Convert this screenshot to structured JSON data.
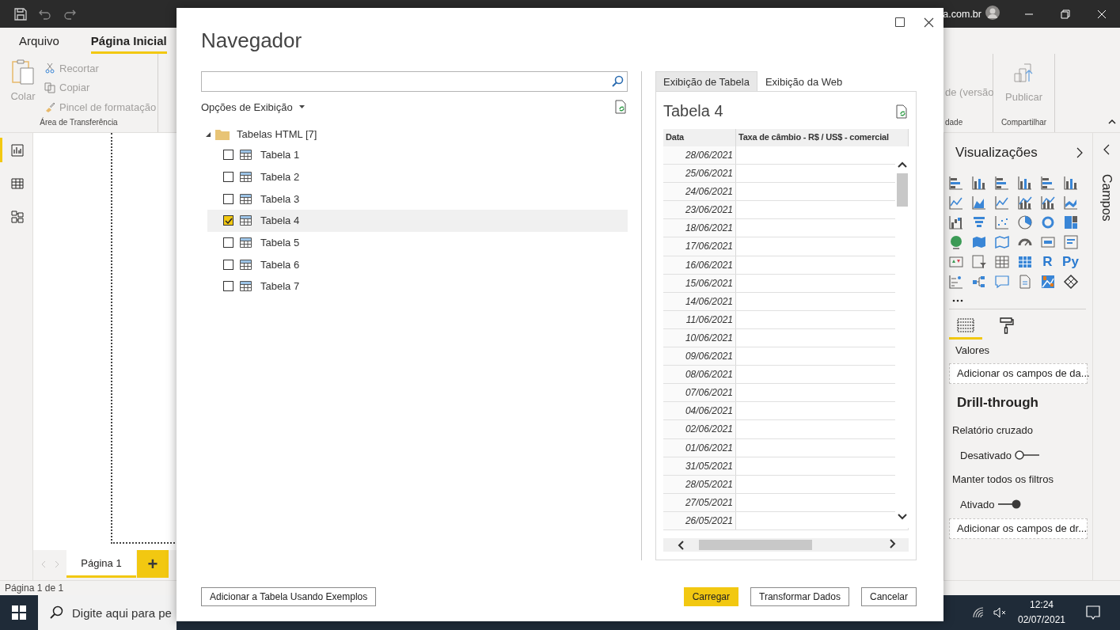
{
  "title_bar": {
    "account_text": "a.com.br"
  },
  "ribbon_tabs": [
    {
      "label": "Arquivo",
      "selected": false
    },
    {
      "label": "Página Inicial",
      "selected": true
    }
  ],
  "ribbon": {
    "clipboard": {
      "paste": {
        "label": "Colar",
        "disabled": true
      },
      "items": [
        {
          "label": "Recortar",
          "disabled": true
        },
        {
          "label": "Copiar",
          "disabled": true
        },
        {
          "label": "Pincel de formatação",
          "disabled": true
        }
      ],
      "group_label": "Área de Transferência"
    },
    "partial_group": {
      "button_label": "de (versão",
      "group_label": "dade"
    },
    "share": {
      "publish": {
        "label": "Publicar",
        "disabled": true
      },
      "group_label": "Compartilhar"
    }
  },
  "views": [
    {
      "selected": true
    },
    {
      "selected": false
    },
    {
      "selected": false
    }
  ],
  "page_tabs": [
    {
      "label": "Página 1",
      "selected": true
    }
  ],
  "add_page_label": "+",
  "status_bar": {
    "text": "Página 1 de 1"
  },
  "visualizations": {
    "title": "Visualizações",
    "visuals": [
      {
        "kind": "icon"
      },
      {
        "kind": "icon"
      },
      {
        "kind": "icon"
      },
      {
        "kind": "icon"
      },
      {
        "kind": "icon"
      },
      {
        "kind": "icon"
      },
      {
        "kind": "icon"
      },
      {
        "kind": "icon"
      },
      {
        "kind": "icon"
      },
      {
        "kind": "icon"
      },
      {
        "kind": "icon"
      },
      {
        "kind": "icon"
      },
      {
        "kind": "icon"
      },
      {
        "kind": "icon"
      },
      {
        "kind": "icon"
      },
      {
        "kind": "icon"
      },
      {
        "kind": "icon"
      },
      {
        "kind": "icon"
      },
      {
        "kind": "icon"
      },
      {
        "kind": "icon"
      },
      {
        "kind": "icon"
      },
      {
        "kind": "icon"
      },
      {
        "kind": "icon"
      },
      {
        "kind": "icon"
      },
      {
        "kind": "icon"
      },
      {
        "kind": "icon"
      },
      {
        "kind": "icon"
      },
      {
        "kind": "icon"
      },
      {
        "kind": "text",
        "label": "R"
      },
      {
        "kind": "text",
        "label": "Py"
      },
      {
        "kind": "icon"
      },
      {
        "kind": "icon"
      },
      {
        "kind": "icon"
      },
      {
        "kind": "icon"
      },
      {
        "kind": "icon"
      },
      {
        "kind": "icon"
      }
    ],
    "pane_tabs": [
      {
        "selected": true
      },
      {
        "selected": false
      }
    ],
    "values_label": "Valores",
    "values_well": "Adicionar os campos de da...",
    "drill_title": "Drill-through",
    "cross_report": {
      "label": "Relatório cruzado",
      "state_label": "Desativado",
      "on": false
    },
    "keep_filters": {
      "label": "Manter todos os filtros",
      "state_label": "Ativado",
      "on": true
    },
    "drill_well": "Adicionar os campos de dr..."
  },
  "fields_pane": {
    "title": "Campos"
  },
  "taskbar": {
    "search_placeholder": "Digite aqui para pe",
    "time": "12:24",
    "date": "02/07/2021"
  },
  "navigator": {
    "title": "Navegador",
    "display_options_label": "Opções de Exibição",
    "tree": [
      {
        "label": "Tabelas HTML [7]",
        "expanded": true,
        "children": [
          {
            "label": "Tabela 1",
            "checked": false,
            "selected": false
          },
          {
            "label": "Tabela 2",
            "checked": false,
            "selected": false
          },
          {
            "label": "Tabela 3",
            "checked": false,
            "selected": false
          },
          {
            "label": "Tabela 4",
            "checked": true,
            "selected": true
          },
          {
            "label": "Tabela 5",
            "checked": false,
            "selected": false
          },
          {
            "label": "Tabela 6",
            "checked": false,
            "selected": false
          },
          {
            "label": "Tabela 7",
            "checked": false,
            "selected": false
          }
        ]
      }
    ],
    "preview": {
      "tabs": [
        {
          "label": "Exibição de Tabela",
          "selected": true
        },
        {
          "label": "Exibição da Web",
          "selected": false
        }
      ],
      "title": "Tabela 4",
      "columns": [
        "Data",
        "Taxa de câmbio - R$ / US$ - comercial"
      ],
      "rows": [
        {
          "data": "28/06/2021"
        },
        {
          "data": "25/06/2021"
        },
        {
          "data": "24/06/2021"
        },
        {
          "data": "23/06/2021"
        },
        {
          "data": "18/06/2021"
        },
        {
          "data": "17/06/2021"
        },
        {
          "data": "16/06/2021"
        },
        {
          "data": "15/06/2021"
        },
        {
          "data": "14/06/2021"
        },
        {
          "data": "11/06/2021"
        },
        {
          "data": "10/06/2021"
        },
        {
          "data": "09/06/2021"
        },
        {
          "data": "08/06/2021"
        },
        {
          "data": "07/06/2021"
        },
        {
          "data": "04/06/2021"
        },
        {
          "data": "02/06/2021"
        },
        {
          "data": "01/06/2021"
        },
        {
          "data": "31/05/2021"
        },
        {
          "data": "28/05/2021"
        },
        {
          "data": "27/05/2021"
        },
        {
          "data": "26/05/2021"
        }
      ]
    },
    "left_button": "Adicionar a Tabela Usando Exemplos",
    "footer_buttons": [
      {
        "label": "Carregar",
        "kind": "primary"
      },
      {
        "label": "Transformar Dados",
        "kind": "default"
      },
      {
        "label": "Cancelar",
        "kind": "default"
      }
    ]
  }
}
